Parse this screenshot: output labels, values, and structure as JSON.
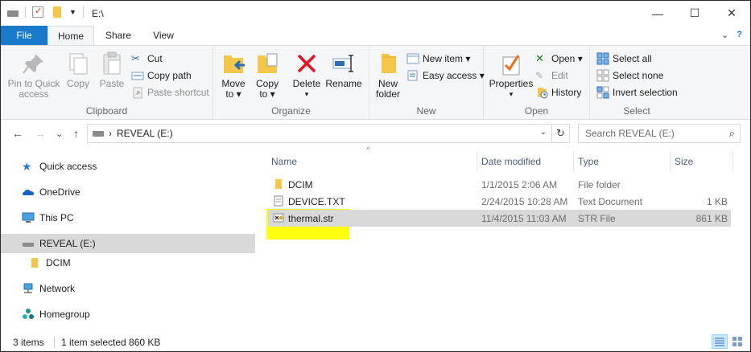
{
  "title": {
    "path": "E:\\",
    "minimize_label": "—",
    "maximize_label": "☐",
    "close_label": "✕"
  },
  "tabs": {
    "file": "File",
    "home": "Home",
    "share": "Share",
    "view": "View",
    "collapse": "⌄",
    "help": "?"
  },
  "ribbon": {
    "clipboard": {
      "label": "Clipboard",
      "pin_line1": "Pin to Quick",
      "pin_line2": "access",
      "copy": "Copy",
      "paste": "Paste",
      "cut": "Cut",
      "copy_path": "Copy path",
      "paste_shortcut": "Paste shortcut"
    },
    "organize": {
      "label": "Organize",
      "move_to_line1": "Move",
      "move_to_line2": "to ▾",
      "copy_to_line1": "Copy",
      "copy_to_line2": "to ▾",
      "delete_line1": "Delete",
      "delete_line2": "▾",
      "rename": "Rename"
    },
    "new": {
      "label": "New",
      "new_folder_line1": "New",
      "new_folder_line2": "folder",
      "new_item": "New item ▾",
      "easy_access": "Easy access ▾"
    },
    "open": {
      "label": "Open",
      "properties_line1": "Properties",
      "properties_line2": "▾",
      "open": "Open ▾",
      "edit": "Edit",
      "history": "History"
    },
    "select": {
      "label": "Select",
      "select_all": "Select all",
      "select_none": "Select none",
      "invert_selection": "Invert selection"
    }
  },
  "address": {
    "path_separator": "›",
    "location": "REVEAL (E:)",
    "dropdown": "⌄",
    "refresh": "↻",
    "search_placeholder": "Search REVEAL (E:)",
    "search_icon": "⌕"
  },
  "nav": {
    "back": "←",
    "forward": "→",
    "recent": "⌄",
    "up": "↑",
    "items": [
      {
        "label": "Quick access",
        "icon": "star-icon"
      },
      {
        "label": "OneDrive",
        "icon": "cloud-icon"
      },
      {
        "label": "This PC",
        "icon": "computer-icon"
      },
      {
        "label": "REVEAL (E:)",
        "icon": "drive-icon"
      },
      {
        "label": "DCIM",
        "icon": "folder-icon"
      },
      {
        "label": "Network",
        "icon": "network-icon"
      },
      {
        "label": "Homegroup",
        "icon": "homegroup-icon"
      }
    ]
  },
  "columns": {
    "sort_indicator": "^",
    "name": "Name",
    "date": "Date modified",
    "type": "Type",
    "size": "Size"
  },
  "files": [
    {
      "name": "DCIM",
      "date": "1/1/2015 2:06 AM",
      "type": "File folder",
      "size": ""
    },
    {
      "name": "DEVICE.TXT",
      "date": "2/24/2015 10:28 AM",
      "type": "Text Document",
      "size": "1 KB"
    },
    {
      "name": "thermal.str",
      "date": "11/4/2015 11:03 AM",
      "type": "STR File",
      "size": "861 KB"
    }
  ],
  "status": {
    "items": "3 items",
    "selected": "1 item selected  860 KB"
  },
  "colors": {
    "file_tab": "#1979ca",
    "selection": "#d9d9d9",
    "highlight": "#ffff00",
    "delete_red": "#e81123"
  }
}
